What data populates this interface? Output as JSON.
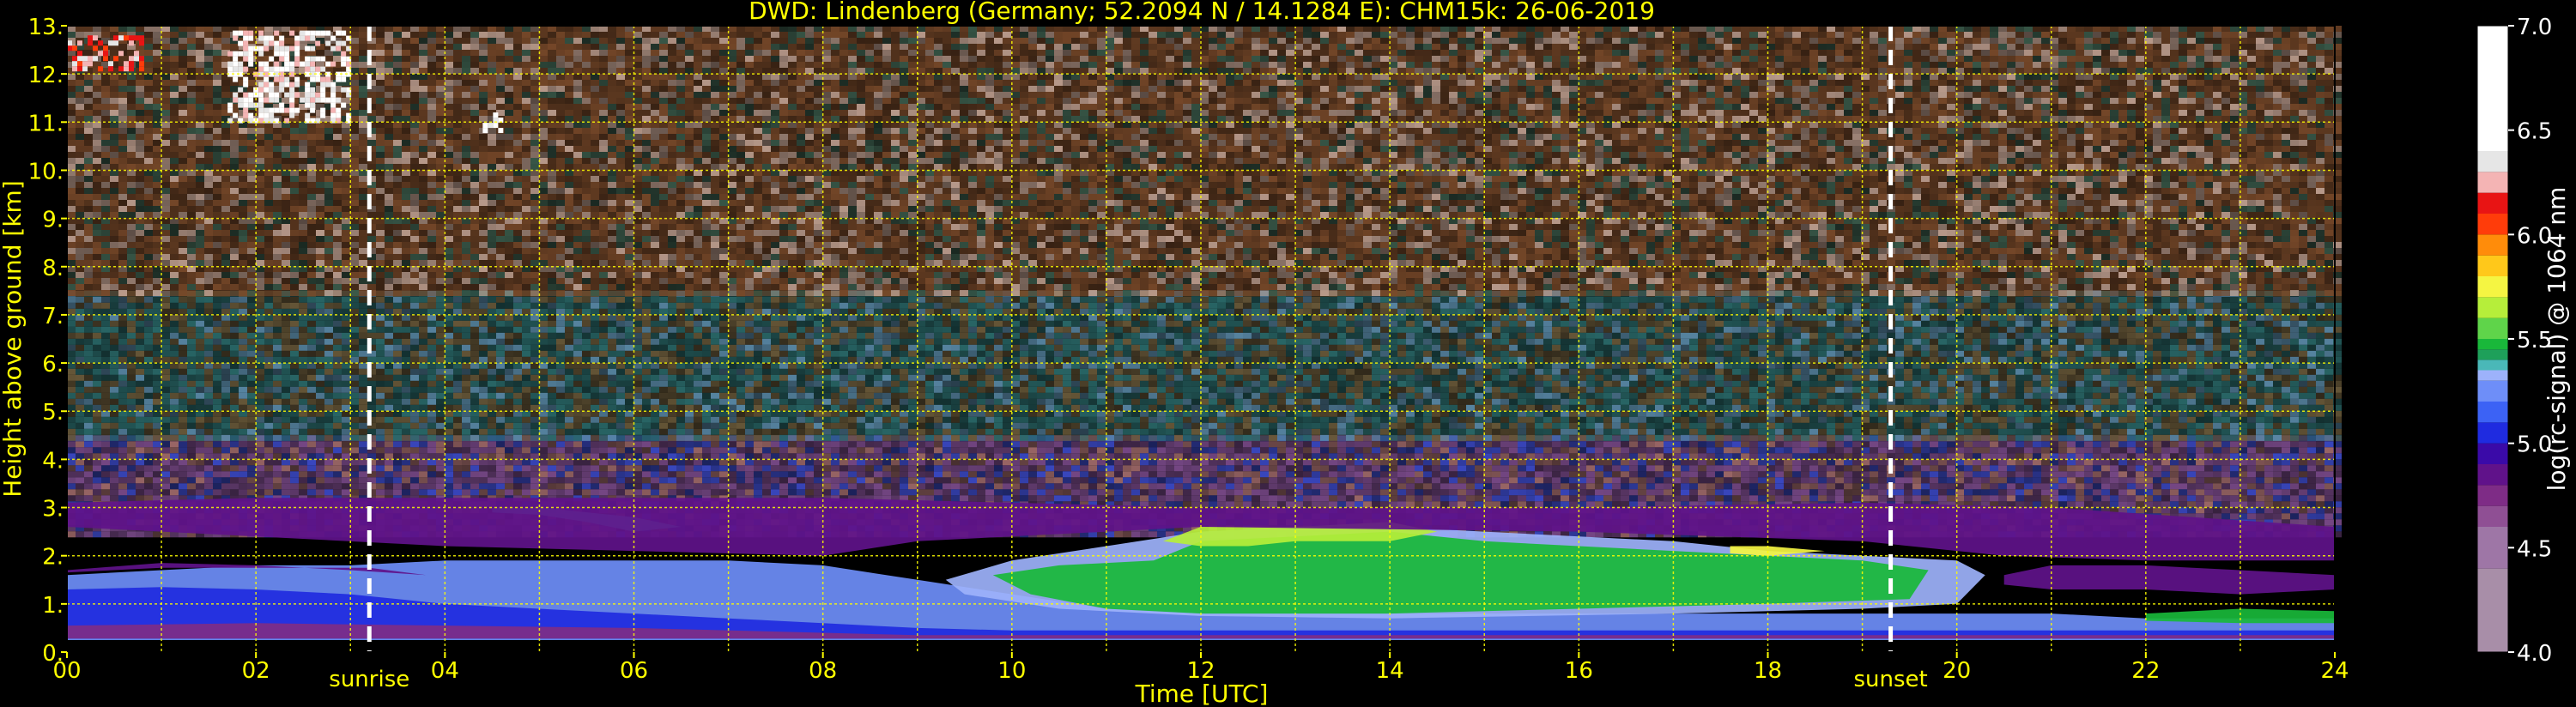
{
  "chart_data": {
    "type": "heatmap",
    "title": "DWD: Lindenberg (Germany; 52.2094 N / 14.1284 E):    CHM15k: 26-06-2019",
    "xlabel": "Time [UTC]",
    "ylabel": "Height above ground [km]",
    "xlim": [
      0,
      24
    ],
    "ylim": [
      0,
      13
    ],
    "x_ticks": [
      "00",
      "02",
      "04",
      "06",
      "08",
      "10",
      "12",
      "14",
      "16",
      "18",
      "20",
      "22",
      "24"
    ],
    "y_ticks": [
      "0.",
      "1.",
      "2.",
      "3.",
      "4.",
      "5.",
      "6.",
      "7.",
      "8.",
      "9.",
      "10.",
      "11.",
      "12.",
      "13."
    ],
    "grid": true,
    "sun_events": [
      {
        "label": "sunrise",
        "time": 3.2
      },
      {
        "label": "sunset",
        "time": 19.3
      }
    ],
    "colorbar": {
      "label": "log(rc-signal) @ 1064 nm",
      "range": [
        4.0,
        7.0
      ],
      "ticks": [
        "4.0",
        "4.5",
        "5.0",
        "5.5",
        "6.0",
        "6.5",
        "7.0"
      ],
      "steps": [
        {
          "from": 4.0,
          "to": 4.4,
          "color": "#a88ea8"
        },
        {
          "from": 4.4,
          "to": 4.6,
          "color": "#9e76a6"
        },
        {
          "from": 4.6,
          "to": 4.7,
          "color": "#8f4f94"
        },
        {
          "from": 4.7,
          "to": 4.8,
          "color": "#7e2c86"
        },
        {
          "from": 4.8,
          "to": 4.9,
          "color": "#60128a"
        },
        {
          "from": 4.9,
          "to": 5.0,
          "color": "#3a0aa8"
        },
        {
          "from": 5.0,
          "to": 5.1,
          "color": "#1f2be0"
        },
        {
          "from": 5.1,
          "to": 5.2,
          "color": "#3c62f5"
        },
        {
          "from": 5.2,
          "to": 5.3,
          "color": "#6e8ef8"
        },
        {
          "from": 5.3,
          "to": 5.35,
          "color": "#9db2fb"
        },
        {
          "from": 5.35,
          "to": 5.4,
          "color": "#4ab8b8"
        },
        {
          "from": 5.4,
          "to": 5.45,
          "color": "#1ea05a"
        },
        {
          "from": 5.45,
          "to": 5.5,
          "color": "#19b83a"
        },
        {
          "from": 5.5,
          "to": 5.6,
          "color": "#5fd44a"
        },
        {
          "from": 5.6,
          "to": 5.7,
          "color": "#b6ee3a"
        },
        {
          "from": 5.7,
          "to": 5.8,
          "color": "#f5f542"
        },
        {
          "from": 5.8,
          "to": 5.9,
          "color": "#ffc81a"
        },
        {
          "from": 5.9,
          "to": 6.0,
          "color": "#ff8c0a"
        },
        {
          "from": 6.0,
          "to": 6.1,
          "color": "#ff3c0a"
        },
        {
          "from": 6.1,
          "to": 6.2,
          "color": "#e81414"
        },
        {
          "from": 6.2,
          "to": 6.3,
          "color": "#f4b4b4"
        },
        {
          "from": 6.3,
          "to": 6.4,
          "color": "#e6e6e6"
        },
        {
          "from": 6.4,
          "to": 7.0,
          "color": "#ffffff"
        }
      ]
    },
    "layers": [
      {
        "value": 5.2,
        "points": [
          [
            0,
            0.3
          ],
          [
            0,
            1.6
          ],
          [
            1,
            1.7
          ],
          [
            2,
            1.8
          ],
          [
            3,
            1.8
          ],
          [
            4,
            1.9
          ],
          [
            5,
            1.9
          ],
          [
            6,
            1.9
          ],
          [
            7,
            1.9
          ],
          [
            8,
            1.8
          ],
          [
            9,
            1.5
          ],
          [
            10,
            1.2
          ],
          [
            11,
            0.9
          ],
          [
            12,
            0.8
          ],
          [
            13,
            0.8
          ],
          [
            14,
            0.8
          ],
          [
            15,
            0.8
          ],
          [
            16,
            0.8
          ],
          [
            17,
            0.8
          ],
          [
            18,
            0.8
          ],
          [
            19,
            0.8
          ],
          [
            20,
            0.8
          ],
          [
            21,
            0.8
          ],
          [
            22,
            0.7
          ],
          [
            23,
            0.7
          ],
          [
            24,
            0.7
          ],
          [
            24,
            0.25
          ],
          [
            0,
            0.25
          ]
        ]
      },
      {
        "value": 5.05,
        "points": [
          [
            0,
            0.3
          ],
          [
            0,
            1.3
          ],
          [
            1,
            1.35
          ],
          [
            2,
            1.3
          ],
          [
            3,
            1.2
          ],
          [
            4,
            1.0
          ],
          [
            5,
            0.9
          ],
          [
            6,
            0.8
          ],
          [
            7,
            0.7
          ],
          [
            8,
            0.6
          ],
          [
            9,
            0.5
          ],
          [
            10,
            0.45
          ],
          [
            20,
            0.45
          ],
          [
            22,
            0.45
          ],
          [
            24,
            0.45
          ],
          [
            24,
            0.28
          ],
          [
            0,
            0.28
          ]
        ]
      },
      {
        "value": 4.75,
        "points": [
          [
            0,
            0.3
          ],
          [
            0,
            0.55
          ],
          [
            2,
            0.6
          ],
          [
            4,
            0.55
          ],
          [
            6,
            0.5
          ],
          [
            8,
            0.4
          ],
          [
            9,
            0.35
          ],
          [
            24,
            0.35
          ],
          [
            24,
            0.28
          ],
          [
            0,
            0.28
          ]
        ]
      },
      {
        "value": 4.85,
        "points": [
          [
            0,
            1.7
          ],
          [
            1,
            1.85
          ],
          [
            2,
            1.8
          ],
          [
            3,
            1.7
          ],
          [
            3.8,
            1.6
          ],
          [
            3.2,
            1.75
          ],
          [
            2,
            1.75
          ],
          [
            1,
            1.75
          ],
          [
            0,
            1.65
          ]
        ]
      },
      {
        "value": 5.32,
        "points": [
          [
            9.3,
            1.5
          ],
          [
            10,
            1.9
          ],
          [
            11,
            2.2
          ],
          [
            12,
            2.5
          ],
          [
            13,
            2.6
          ],
          [
            14,
            2.6
          ],
          [
            15,
            2.5
          ],
          [
            16,
            2.4
          ],
          [
            17,
            2.3
          ],
          [
            18,
            2.1
          ],
          [
            19,
            2.0
          ],
          [
            20,
            1.9
          ],
          [
            20.3,
            1.6
          ],
          [
            20,
            1.0
          ],
          [
            19,
            0.9
          ],
          [
            17,
            0.8
          ],
          [
            14,
            0.7
          ],
          [
            12,
            0.75
          ],
          [
            10.5,
            0.9
          ],
          [
            9.5,
            1.2
          ]
        ]
      },
      {
        "value": 5.48,
        "points": [
          [
            9.8,
            1.6
          ],
          [
            10.5,
            1.8
          ],
          [
            11.5,
            1.9
          ],
          [
            12,
            2.3
          ],
          [
            13,
            2.4
          ],
          [
            14,
            2.5
          ],
          [
            15,
            2.3
          ],
          [
            16,
            2.2
          ],
          [
            17,
            2.1
          ],
          [
            18,
            2.0
          ],
          [
            19,
            1.9
          ],
          [
            19.7,
            1.7
          ],
          [
            19.5,
            1.1
          ],
          [
            18,
            1.0
          ],
          [
            16,
            0.9
          ],
          [
            14,
            0.8
          ],
          [
            12,
            0.8
          ],
          [
            11,
            0.9
          ],
          [
            10.2,
            1.2
          ]
        ]
      },
      {
        "value": 5.65,
        "points": [
          [
            11.6,
            2.3
          ],
          [
            12,
            2.6
          ],
          [
            13,
            2.6
          ],
          [
            14,
            2.7
          ],
          [
            14.5,
            2.5
          ],
          [
            14,
            2.3
          ],
          [
            13,
            2.3
          ],
          [
            12.5,
            2.2
          ],
          [
            12,
            2.2
          ]
        ]
      },
      {
        "value": 5.75,
        "points": [
          [
            17.6,
            2.2
          ],
          [
            18,
            2.2
          ],
          [
            18.6,
            2.1
          ],
          [
            18,
            2.0
          ],
          [
            17.6,
            2.05
          ]
        ]
      },
      {
        "value": 5.35,
        "points": [
          [
            4.5,
            3.0
          ],
          [
            5,
            3.0
          ],
          [
            6,
            2.8
          ],
          [
            6.5,
            2.6
          ],
          [
            6,
            2.5
          ],
          [
            5.5,
            2.7
          ],
          [
            5,
            2.85
          ],
          [
            4.5,
            2.9
          ]
        ]
      },
      {
        "value": 4.8,
        "points": [
          [
            20.5,
            1.6
          ],
          [
            21,
            1.8
          ],
          [
            22,
            1.8
          ],
          [
            23,
            1.7
          ],
          [
            24,
            1.6
          ],
          [
            24,
            1.3
          ],
          [
            23,
            1.2
          ],
          [
            22,
            1.3
          ],
          [
            21,
            1.3
          ],
          [
            20.5,
            1.4
          ]
        ]
      },
      {
        "value": 5.45,
        "points": [
          [
            22,
            0.8
          ],
          [
            23,
            0.9
          ],
          [
            24,
            0.85
          ],
          [
            24,
            0.6
          ],
          [
            23,
            0.6
          ],
          [
            22,
            0.65
          ]
        ]
      },
      {
        "value": 4.85,
        "points": [
          [
            4.5,
            3.2
          ],
          [
            8,
            3.2
          ],
          [
            10,
            3.1
          ],
          [
            12,
            3.0
          ],
          [
            16,
            3.0
          ],
          [
            19,
            3.1
          ],
          [
            21,
            3.0
          ],
          [
            22.5,
            2.8
          ],
          [
            24,
            2.6
          ],
          [
            24,
            1.9
          ],
          [
            22,
            1.9
          ],
          [
            20.5,
            2.0
          ],
          [
            19,
            2.3
          ],
          [
            16,
            2.5
          ],
          [
            12,
            2.6
          ],
          [
            9,
            2.3
          ],
          [
            8,
            2.0
          ],
          [
            6,
            2.1
          ],
          [
            4,
            2.2
          ],
          [
            2,
            2.4
          ],
          [
            0,
            2.6
          ],
          [
            0,
            3.1
          ],
          [
            2,
            3.2
          ]
        ]
      }
    ],
    "noise_regions": [
      {
        "y": [
          2.5,
          4.5
        ],
        "weights": [
          0.55,
          0.25,
          0.2
        ],
        "colors": [
          "#7a4a8a",
          "#3c4ac8",
          "#a06a6a"
        ]
      },
      {
        "y": [
          4.5,
          7.5
        ],
        "weights": [
          0.45,
          0.35,
          0.2
        ],
        "colors": [
          "#2a6a6a",
          "#6a5a3a",
          "#5a8aa8"
        ]
      },
      {
        "y": [
          7.5,
          13.0
        ],
        "weights": [
          0.6,
          0.25,
          0.15
        ],
        "colors": [
          "#7a4a2a",
          "#c0a090",
          "#3a5a4a"
        ]
      }
    ],
    "cloud_patches": [
      {
        "x": [
          0.0,
          0.8
        ],
        "y": [
          12.1,
          12.8
        ],
        "value": 6.2
      },
      {
        "x": [
          1.7,
          3.0
        ],
        "y": [
          11.0,
          12.9
        ],
        "value": 6.4
      },
      {
        "x": [
          4.4,
          4.6
        ],
        "y": [
          10.7,
          11.2
        ],
        "value": 6.5
      }
    ]
  }
}
